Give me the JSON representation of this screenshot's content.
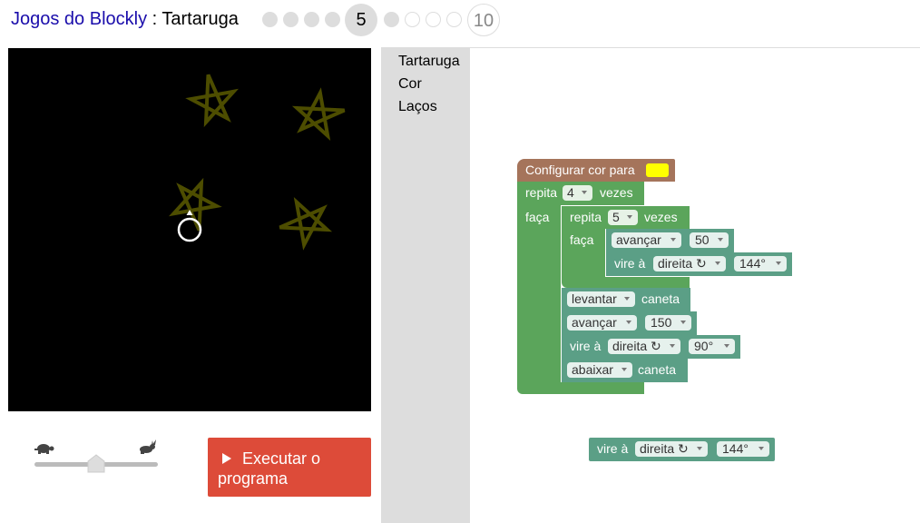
{
  "header": {
    "app_name": "Jogos do Blockly",
    "separator": " : ",
    "game_name": "Tartaruga",
    "current_level": "5",
    "last_level": "10"
  },
  "colors": {
    "run_button": "#dd4b39",
    "toolbox_bg": "#dddddd",
    "stroke_yellow": "#ffff00",
    "brown_block": "#a5745b",
    "green_block": "#5ba55b",
    "teal_block": "#5b9f86"
  },
  "controls": {
    "run_label": "Executar o programa",
    "speed_slow_icon": "turtle-icon",
    "speed_fast_icon": "rabbit-icon",
    "speed_value": 0.5
  },
  "toolbox": {
    "categories": [
      "Tartaruga",
      "Cor",
      "Laços"
    ]
  },
  "blocks": {
    "set_color": {
      "label": "Configurar cor para",
      "color": "#ffff00"
    },
    "outer_repeat": {
      "label": "repita",
      "count": "4",
      "suffix": "vezes",
      "do": "faça"
    },
    "inner_repeat": {
      "label": "repita",
      "count": "5",
      "suffix": "vezes",
      "do": "faça"
    },
    "move_1": {
      "label": "avançar",
      "value": "50"
    },
    "turn_1": {
      "prefix": "vire à",
      "direction": "direita ↻",
      "angle": "144°"
    },
    "pen_up": {
      "action": "levantar",
      "suffix": "caneta"
    },
    "move_2": {
      "label": "avançar",
      "value": "150"
    },
    "turn_2": {
      "prefix": "vire à",
      "direction": "direita ↻",
      "angle": "90°"
    },
    "pen_down": {
      "action": "abaixar",
      "suffix": "caneta"
    },
    "loose_turn": {
      "prefix": "vire à",
      "direction": "direita ↻",
      "angle": "144°"
    }
  }
}
